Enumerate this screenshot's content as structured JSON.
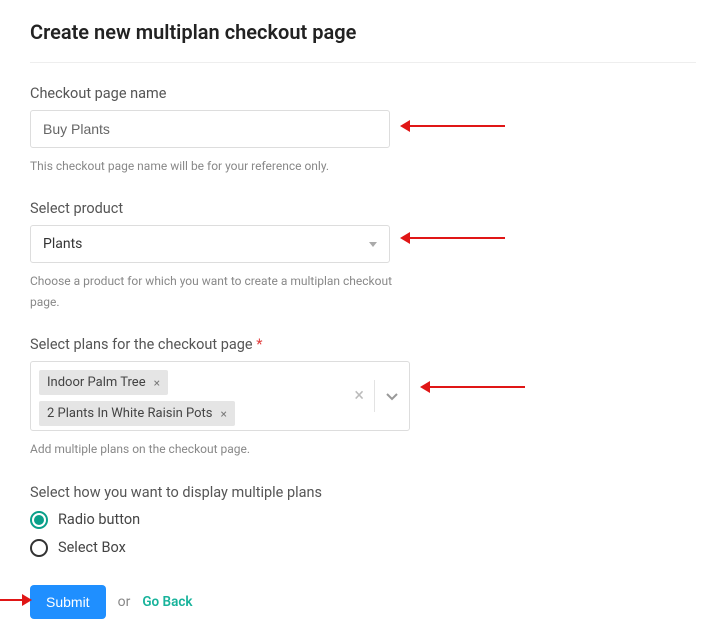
{
  "title": "Create new multiplan checkout page",
  "checkout_name": {
    "label": "Checkout page name",
    "value": "Buy Plants",
    "hint": "This checkout page name will be for your reference only."
  },
  "product": {
    "label": "Select product",
    "value": "Plants",
    "hint": "Choose a product for which you want to create a multiplan checkout page."
  },
  "plans": {
    "label": "Select plans for the checkout page",
    "required_mark": "*",
    "selected": [
      "Indoor Palm Tree",
      "2 Plants In White Raisin Pots"
    ],
    "hint": "Add multiple plans on the checkout page."
  },
  "display": {
    "label": "Select how you want to display multiple plans",
    "options": [
      "Radio button",
      "Select Box"
    ],
    "selected_index": 0
  },
  "actions": {
    "submit": "Submit",
    "or": "or",
    "go_back": "Go Back"
  }
}
